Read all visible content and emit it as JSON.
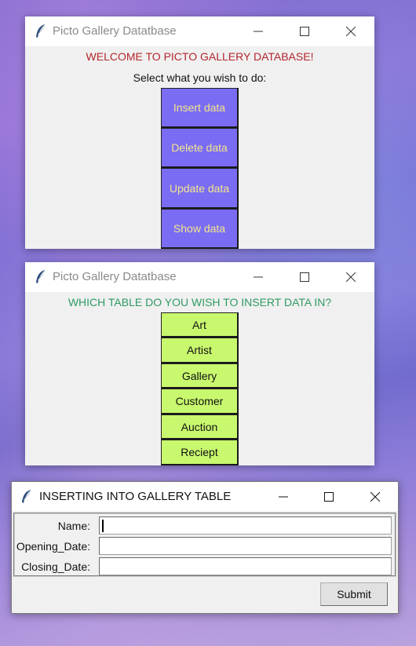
{
  "window1": {
    "title": "Picto Gallery Datatbase",
    "welcome": "WELCOME TO PICTO GALLERY DATABASE!",
    "prompt": "Select what you wish to do:",
    "buttons": [
      "Insert data",
      "Delete data",
      "Update data",
      "Show data"
    ]
  },
  "window2": {
    "title": "Picto Gallery Datatbase",
    "question": "WHICH TABLE DO YOU WISH TO INSERT DATA IN?",
    "buttons": [
      "Art",
      "Artist",
      "Gallery",
      "Customer",
      "Auction",
      "Reciept"
    ]
  },
  "window3": {
    "title": "INSERTING INTO GALLERY TABLE",
    "fields": [
      {
        "label": "Name:",
        "value": ""
      },
      {
        "label": "Opening_Date:",
        "value": ""
      },
      {
        "label": "Closing_Date:",
        "value": ""
      }
    ],
    "submit_label": "Submit"
  },
  "colors": {
    "welcome_text": "#b3262e",
    "question_text": "#2e9a63",
    "purple_button": "#7b6cf4",
    "purple_button_text": "#f2e68a",
    "green_button": "#c8f86e"
  },
  "icons": {
    "app_icon": "feather-icon",
    "minimize": "minimize-icon",
    "maximize": "maximize-icon",
    "close": "close-icon"
  }
}
